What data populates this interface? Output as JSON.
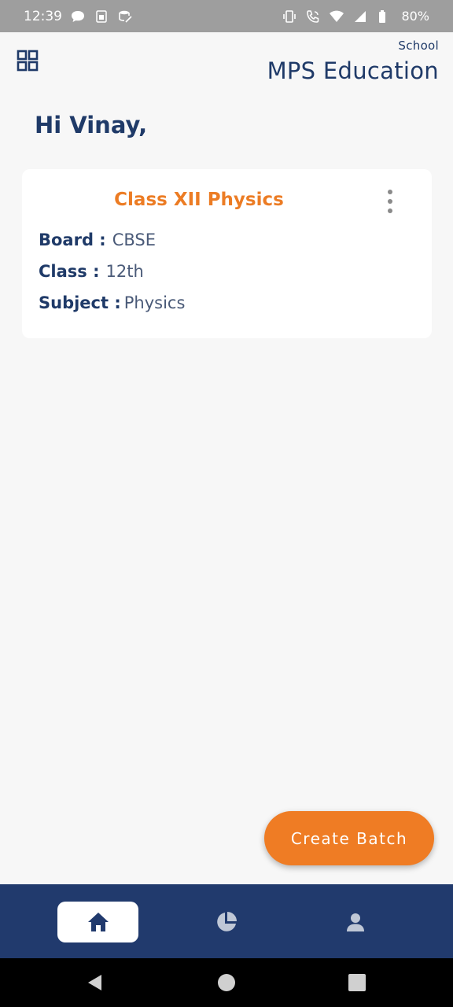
{
  "status_bar": {
    "time": "12:39",
    "battery": "80%",
    "left_icons": [
      "message-icon",
      "sim-icon",
      "storage-icon"
    ],
    "right_icons": [
      "vibrate-icon",
      "wifi-call-icon",
      "wifi-icon",
      "signal-icon",
      "battery-icon"
    ]
  },
  "header": {
    "menu_icon": "grid-icon",
    "school_label": "School",
    "school_name": "MPS Education"
  },
  "greeting": "Hi Vinay,",
  "batch_card": {
    "title": "Class XII Physics",
    "fields": [
      {
        "label": "Board :",
        "value": "CBSE"
      },
      {
        "label": "Class :",
        "value": "12th"
      },
      {
        "label": "Subject :",
        "value": "Physics"
      }
    ]
  },
  "fab": {
    "label": "Create Batch"
  },
  "bottom_nav": {
    "items": [
      {
        "icon": "home-icon",
        "active": true
      },
      {
        "icon": "pie-chart-icon",
        "active": false
      },
      {
        "icon": "person-icon",
        "active": false
      }
    ]
  },
  "system_nav": [
    "back-icon",
    "home-circle-icon",
    "recents-icon"
  ],
  "colors": {
    "primary": "#213a6d",
    "accent": "#ef7c24",
    "background": "#f7f7f7"
  }
}
